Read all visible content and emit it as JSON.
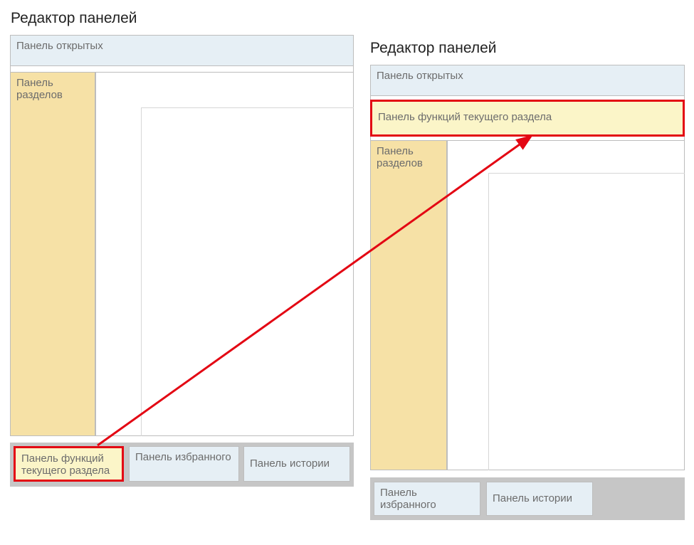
{
  "left": {
    "title": "Редактор панелей",
    "panel_open": "Панель открытых",
    "panel_sections": "Панель разделов",
    "tray_functions": "Панель функций текущего раздела",
    "tray_favorites": "Панель избранного",
    "tray_history": "Панель истории"
  },
  "right": {
    "title": "Редактор панелей",
    "panel_open": "Панель открытых",
    "panel_functions": "Панель функций текущего раздела",
    "panel_sections": "Панель разделов",
    "tray_favorites": "Панель избранного",
    "tray_history": "Панель истории"
  }
}
